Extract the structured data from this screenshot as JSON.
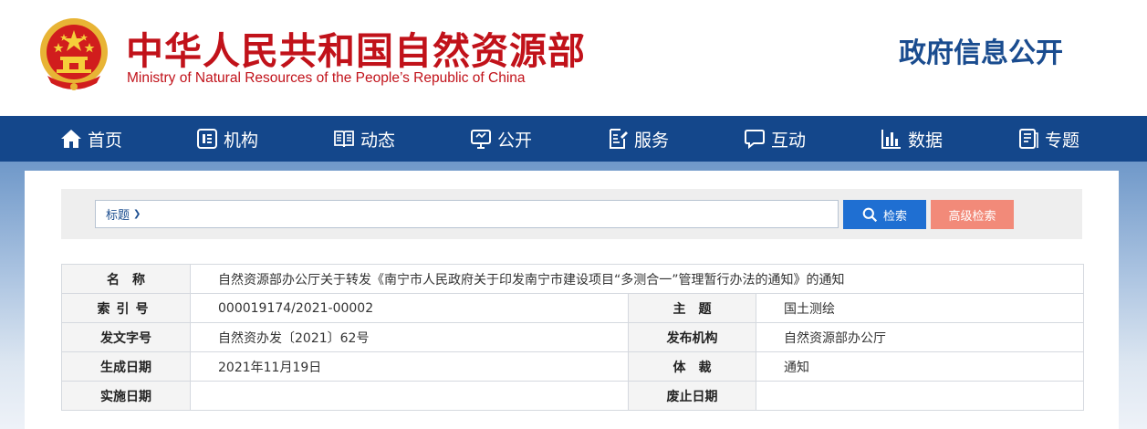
{
  "header": {
    "title": "中华人民共和国自然资源部",
    "subtitle": "Ministry of Natural Resources of the People’s Republic of China",
    "section": "政府信息公开",
    "emblem_icon": "national-emblem-icon"
  },
  "colors": {
    "brand_red": "#c1121a",
    "nav_blue": "#14478b",
    "search_blue": "#1f6fd2",
    "advanced_salmon": "#f28a79"
  },
  "nav": {
    "items": [
      {
        "label": "首页",
        "icon": "home-icon"
      },
      {
        "label": "机构",
        "icon": "organization-icon"
      },
      {
        "label": "动态",
        "icon": "book-icon"
      },
      {
        "label": "公开",
        "icon": "monitor-icon"
      },
      {
        "label": "服务",
        "icon": "document-edit-icon"
      },
      {
        "label": "互动",
        "icon": "chat-icon"
      },
      {
        "label": "数据",
        "icon": "bar-chart-icon"
      },
      {
        "label": "专题",
        "icon": "topic-icon"
      }
    ]
  },
  "search": {
    "field": "标题",
    "query": "",
    "search_label": "检索",
    "advanced_label": "高级检索"
  },
  "info": {
    "name_label": "名　称",
    "name_value": "自然资源部办公厅关于转发《南宁市人民政府关于印发南宁市建设项目“多测合一”管理暂行办法的通知》的通知",
    "index_label": "索引号",
    "index_value": "000019174/2021-00002",
    "topic_label": "主　题",
    "topic_value": "国土测绘",
    "docno_label": "发文字号",
    "docno_value": "自然资办发〔2021〕62号",
    "publisher_label": "发布机构",
    "publisher_value": "自然资源部办公厅",
    "created_label": "生成日期",
    "created_value": "2021年11月19日",
    "genre_label": "体　裁",
    "genre_value": "通知",
    "effective_label": "实施日期",
    "effective_value": "",
    "expiry_label": "废止日期",
    "expiry_value": ""
  }
}
